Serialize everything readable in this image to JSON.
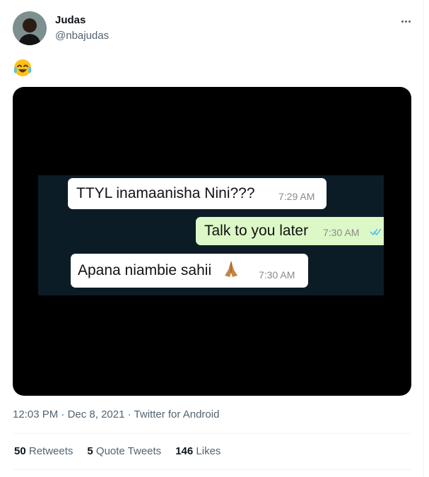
{
  "author": {
    "name": "Judas",
    "handle": "@nbajudas"
  },
  "tweet_text_emoji": "😂",
  "icons": {
    "more": "more-icon",
    "emoji": "face-with-tears-of-joy",
    "avatar": "avatar",
    "check": "double-check-icon",
    "pray": "folded-hands-emoji"
  },
  "media": {
    "messages": [
      {
        "direction": "incoming",
        "text": "TTYL inamaanisha Nini???",
        "time": "7:29 AM"
      },
      {
        "direction": "outgoing",
        "text": "Talk to you later",
        "time": "7:30 AM"
      },
      {
        "direction": "incoming",
        "text": "Apana niambie sahii",
        "time": "7:30 AM"
      }
    ]
  },
  "meta": {
    "time": "12:03 PM",
    "date": "Dec 8, 2021",
    "source": "Twitter for Android",
    "separator": "·"
  },
  "stats": {
    "retweets": {
      "count": "50",
      "label": "Retweets"
    },
    "quotes": {
      "count": "5",
      "label": "Quote Tweets"
    },
    "likes": {
      "count": "146",
      "label": "Likes"
    }
  },
  "colors": {
    "outgoing_bubble": "#dcf8c6",
    "incoming_bubble": "#ffffff",
    "chat_bg": "#0c1c27",
    "check": "#4fc3f7"
  }
}
